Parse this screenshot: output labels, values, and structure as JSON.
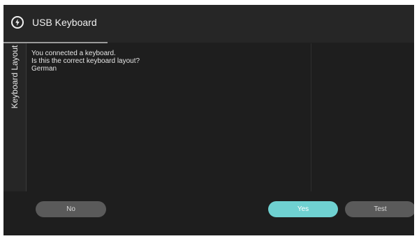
{
  "header": {
    "title": "USB Keyboard",
    "icon": "power-icon"
  },
  "sidebar": {
    "tab_label": "Keyboard Layout"
  },
  "content": {
    "line1": "You connected a keyboard.",
    "line2": "Is this the correct keyboard layout?",
    "layout_value": "German"
  },
  "buttons": {
    "no_label": "No",
    "yes_label": "Yes",
    "test_label": "Test"
  },
  "colors": {
    "background": "#1e1e1e",
    "header_bg": "#262626",
    "accent": "#6fd1d1",
    "button_inactive": "#5a5a5a"
  }
}
